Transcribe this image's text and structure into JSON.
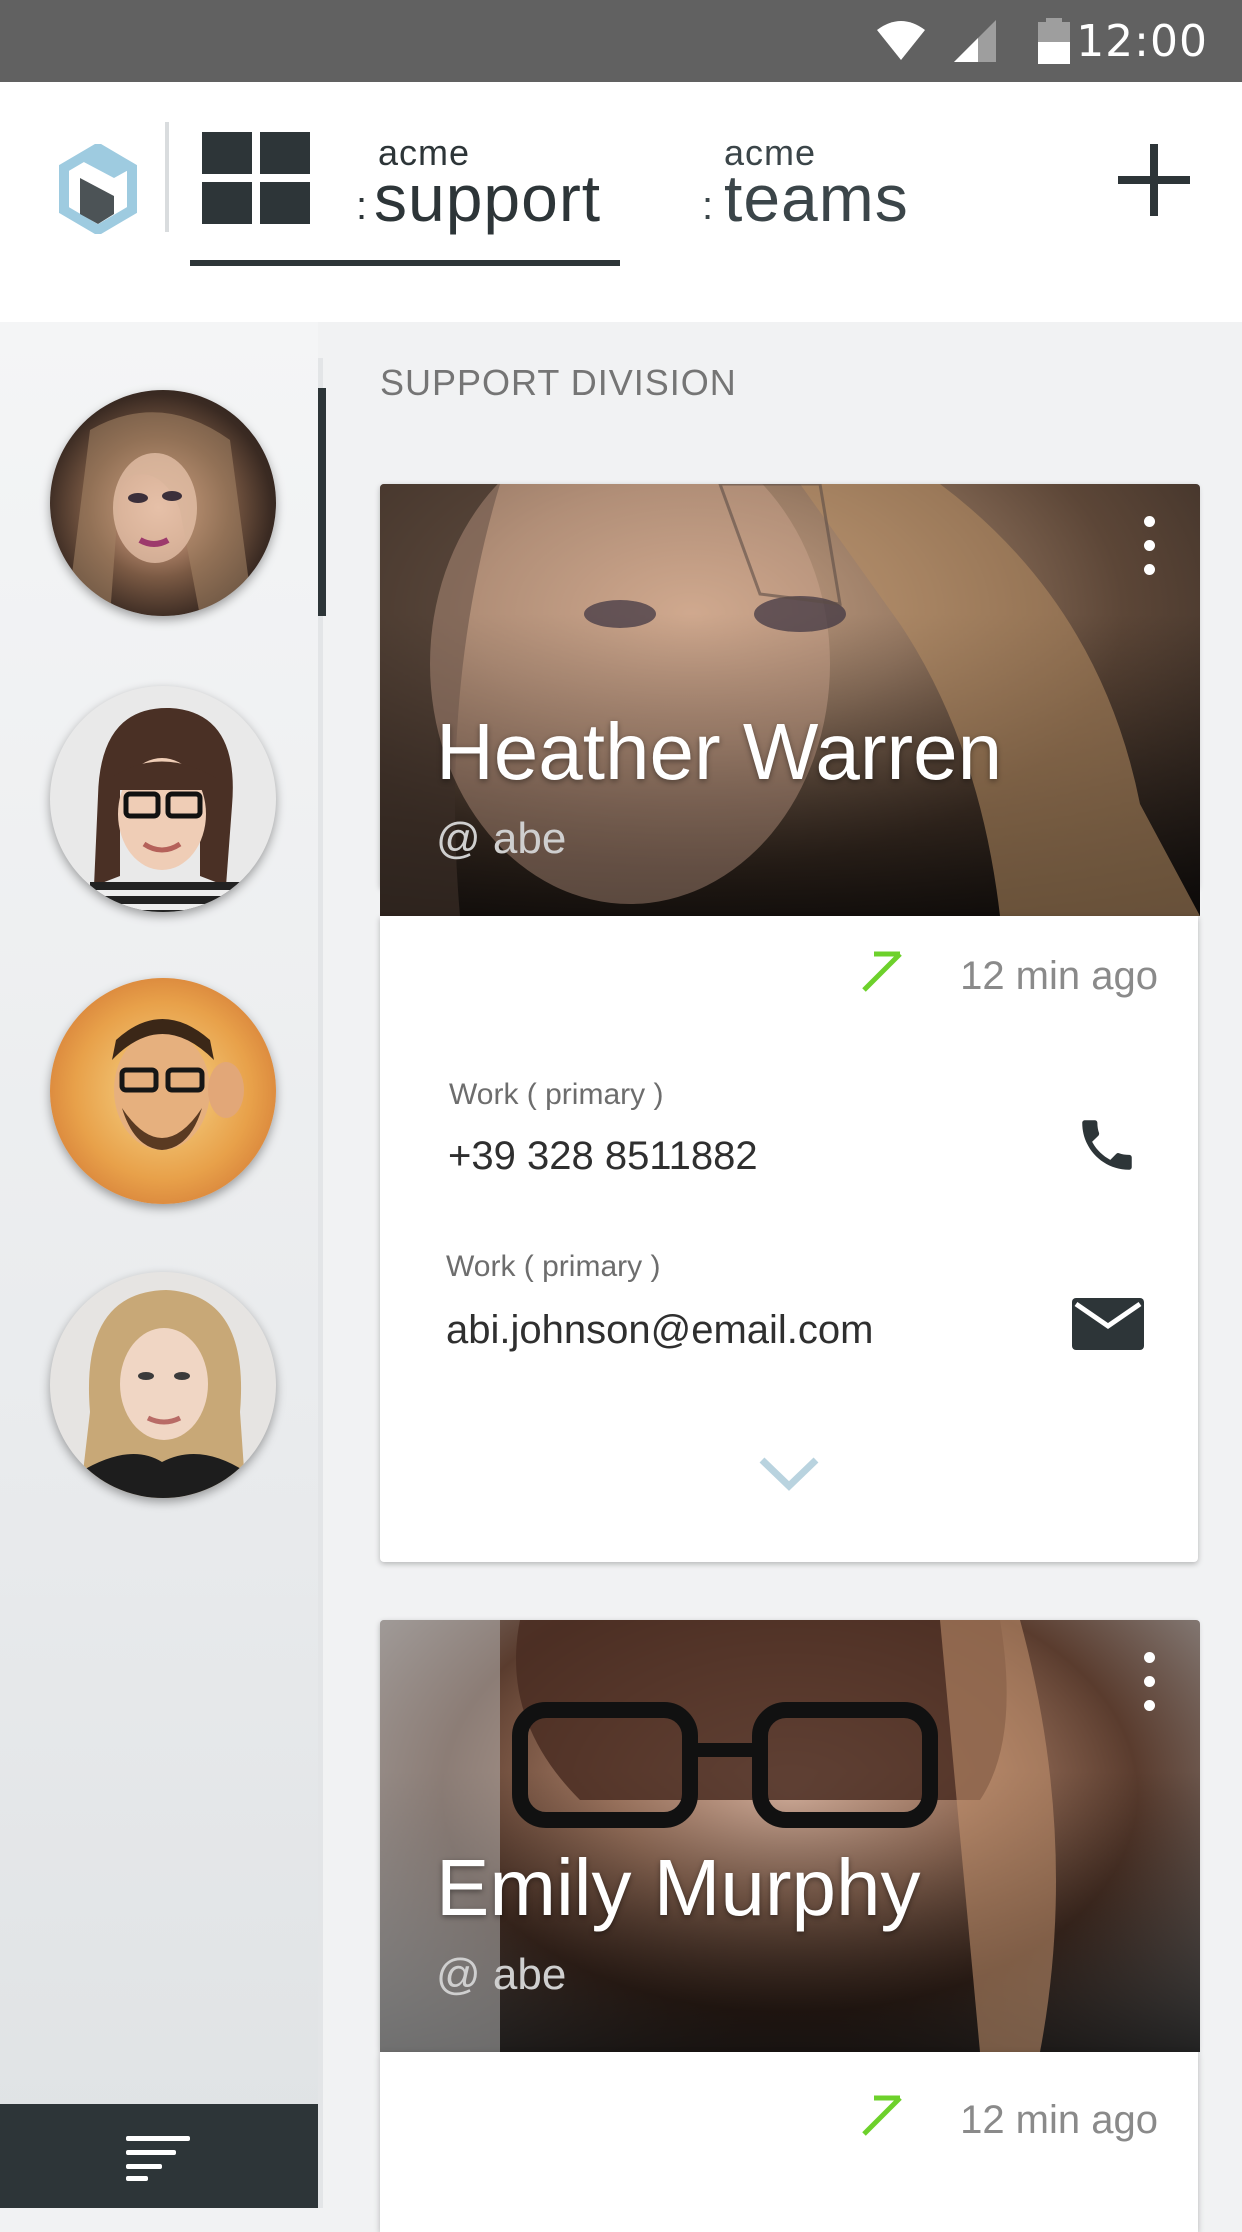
{
  "status_bar": {
    "time": "12:00",
    "icons": [
      "wifi-icon",
      "signal-icon",
      "battery-icon"
    ]
  },
  "header": {
    "logo": "acme-logo-icon",
    "tabs": [
      {
        "prefix": "acme",
        "word": "support",
        "selected": true,
        "icon": "grid-icon"
      },
      {
        "prefix": "acme",
        "word": "teams",
        "selected": false
      }
    ],
    "add_icon": "plus-icon"
  },
  "sidebar": {
    "avatars": [
      "Heather Warren",
      "Emily Murphy",
      "bearded man with glasses",
      "blonde woman"
    ],
    "filter_icon": "filter-icon"
  },
  "main": {
    "section_title": "SUPPORT DIVISION",
    "cards": [
      {
        "name": "Heather Warren",
        "handle": "@ abe",
        "time": "12 min ago",
        "contacts": [
          {
            "label": "Work ( primary )",
            "value": "+39 328 8511882",
            "icon": "phone-icon"
          },
          {
            "label": "Work ( primary )",
            "value": "abi.johnson@email.com",
            "icon": "mail-icon"
          }
        ],
        "expand_icon": "chevron-down-icon"
      },
      {
        "name": "Emily Murphy",
        "handle": "@ abe",
        "time": "12 min ago"
      }
    ]
  },
  "colors": {
    "dark": "#2d3538",
    "accent_green": "#6dd12b",
    "chevron_blue": "#b9d3df",
    "logo_blue": "#9ecbe0"
  }
}
